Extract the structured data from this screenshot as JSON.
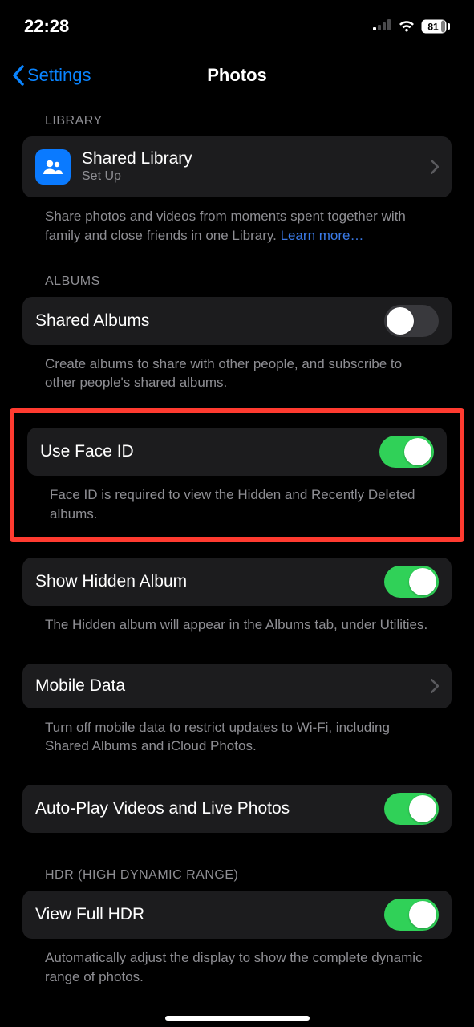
{
  "status": {
    "time": "22:28",
    "battery": "81"
  },
  "nav": {
    "back": "Settings",
    "title": "Photos"
  },
  "library": {
    "header": "LIBRARY",
    "shared_library_title": "Shared Library",
    "shared_library_sub": "Set Up",
    "footer_a": "Share photos and videos from moments spent together with family and close friends in one Library. ",
    "footer_link": "Learn more…"
  },
  "albums": {
    "header": "ALBUMS",
    "shared_albums": "Shared Albums",
    "shared_albums_footer": "Create albums to share with other people, and subscribe to other people's shared albums.",
    "face_id": "Use Face ID",
    "face_id_footer": "Face ID is required to view the Hidden and Recently Deleted albums.",
    "show_hidden": "Show Hidden Album",
    "show_hidden_footer": "The Hidden album will appear in the Albums tab, under Utilities.",
    "mobile_data": "Mobile Data",
    "mobile_data_footer": "Turn off mobile data to restrict updates to Wi-Fi, including Shared Albums and iCloud Photos.",
    "autoplay": "Auto-Play Videos and Live Photos"
  },
  "hdr": {
    "header": "HDR (HIGH DYNAMIC RANGE)",
    "view_full": "View Full HDR",
    "footer": "Automatically adjust the display to show the complete dynamic range of photos."
  }
}
